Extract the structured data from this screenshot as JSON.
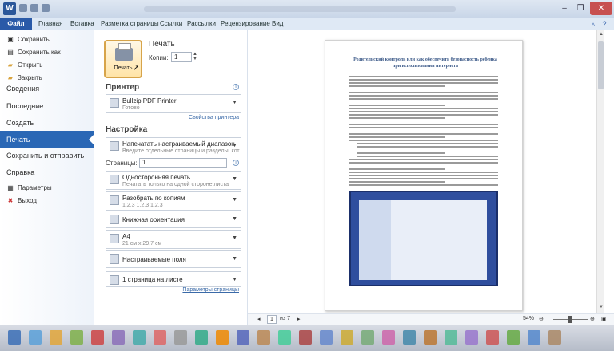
{
  "window": {
    "title": "Bullzip PDF Printer.docx – Microsoft Word",
    "app_badge": "W"
  },
  "ribbon": {
    "file_tab": "Файл",
    "tabs": [
      "Главная",
      "Вставка",
      "Разметка страницы",
      "Ссылки",
      "Рассылки",
      "Рецензирование",
      "Вид"
    ]
  },
  "backstage": {
    "items": [
      {
        "label": "Сохранить",
        "icon": "save-icon"
      },
      {
        "label": "Сохранить как",
        "icon": "save-as-icon"
      },
      {
        "label": "Открыть",
        "icon": "open-folder-icon"
      },
      {
        "label": "Закрыть",
        "icon": "close-doc-icon"
      }
    ],
    "sections": [
      "Сведения",
      "Последние",
      "Создать",
      "Печать",
      "Сохранить и отправить",
      "Справка"
    ],
    "bottom_items": [
      {
        "label": "Параметры",
        "icon": "options-icon"
      },
      {
        "label": "Выход",
        "icon": "exit-icon"
      }
    ]
  },
  "print_panel": {
    "heading": "Печать",
    "print_button": "Печать",
    "copies_label": "Копии:",
    "copies_value": "1",
    "printer_heading": "Принтер",
    "printer_name": "Bullzip PDF Printer",
    "printer_status": "Готово",
    "printer_props_link": "Свойства принтера",
    "settings_heading": "Настройка",
    "settings": [
      {
        "title": "Напечатать настраиваемый диапазон",
        "subtitle": "Введите отдельные страницы и разделы, кот..."
      },
      {
        "title": "Односторонняя печать",
        "subtitle": "Печатать только на одной стороне листа"
      },
      {
        "title": "Разобрать по копиям",
        "subtitle": "1,2,3   1,2,3   1,2,3"
      },
      {
        "title": "Книжная ориентация",
        "subtitle": ""
      },
      {
        "title": "А4",
        "subtitle": "21 см x 29,7 см"
      },
      {
        "title": "Настраиваемые поля",
        "subtitle": ""
      },
      {
        "title": "1 страница на листе",
        "subtitle": ""
      }
    ],
    "pages_label": "Страницы:",
    "pages_value": "1",
    "page_setup_link": "Параметры страницы"
  },
  "preview": {
    "doc_title": "Родительский контроль или как обеспечить безопасность ребенка при использовании интернета",
    "list_items": [
      "Ограничение по времени работы за компьютером",
      "Ограничение по времени работы в интернете",
      "Ограничение по доступу к определенным играм и программам",
      "Ограничение по доступу к определенным ресурсам интернета"
    ]
  },
  "statusbar": {
    "current_page": "1",
    "page_of": "из 7",
    "zoom": "54%"
  }
}
